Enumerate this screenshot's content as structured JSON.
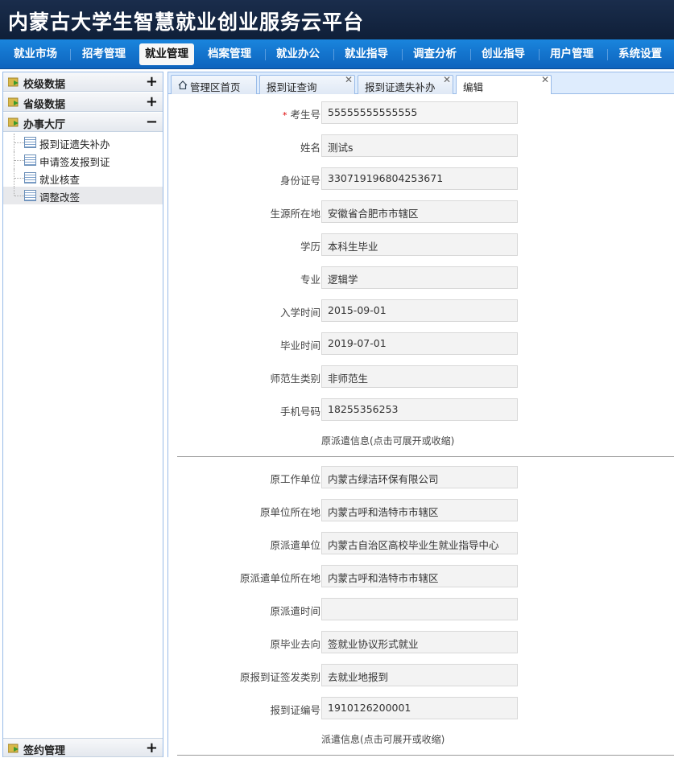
{
  "app": {
    "title": "内蒙古大学生智慧就业创业服务云平台"
  },
  "nav": [
    {
      "label": "就业市场"
    },
    {
      "label": "招考管理"
    },
    {
      "label": "就业管理",
      "active": true
    },
    {
      "label": "档案管理"
    },
    {
      "label": "就业办公"
    },
    {
      "label": "就业指导"
    },
    {
      "label": "调查分析"
    },
    {
      "label": "创业指导"
    },
    {
      "label": "用户管理"
    },
    {
      "label": "系统设置"
    }
  ],
  "sidebar": {
    "groups": [
      {
        "label": "校级数据",
        "toggle": "+"
      },
      {
        "label": "省级数据",
        "toggle": "+"
      },
      {
        "label": "办事大厅",
        "toggle": "−"
      }
    ],
    "items": [
      {
        "label": "报到证遗失补办"
      },
      {
        "label": "申请签发报到证"
      },
      {
        "label": "就业核查"
      },
      {
        "label": "调整改签",
        "selected": true
      }
    ],
    "bottom": {
      "label": "签约管理",
      "toggle": "+"
    }
  },
  "tabs": [
    {
      "label": "管理区首页",
      "icon": "home-icon",
      "closable": false
    },
    {
      "label": "报到证查询",
      "closable": true
    },
    {
      "label": "报到证遗失补办",
      "closable": true
    },
    {
      "label": "编辑",
      "closable": true,
      "active": true
    }
  ],
  "close_glyph": "✕",
  "form": {
    "required_mark": "*",
    "fields": [
      {
        "label": "考生号",
        "value": "55555555555555",
        "required": true
      },
      {
        "label": "姓名",
        "value": "测试s"
      },
      {
        "label": "身份证号",
        "value": "330719196804253671"
      },
      {
        "label": "生源所在地",
        "value": "安徽省合肥市市辖区"
      },
      {
        "label": "学历",
        "value": "本科生毕业"
      },
      {
        "label": "专业",
        "value": "逻辑学"
      },
      {
        "label": "入学时间",
        "value": "2015-09-01"
      },
      {
        "label": "毕业时间",
        "value": "2019-07-01"
      },
      {
        "label": "师范生类别",
        "value": "非师范生"
      },
      {
        "label": "手机号码",
        "value": "18255356253"
      }
    ],
    "section1_link": "原派遣信息(点击可展开或收缩)",
    "section1_fields": [
      {
        "label": "原工作单位",
        "value": "内蒙古绿洁环保有限公司"
      },
      {
        "label": "原单位所在地",
        "value": "内蒙古呼和浩特市市辖区"
      },
      {
        "label": "原派遣单位",
        "value": "内蒙古自治区高校毕业生就业指导中心"
      },
      {
        "label": "原派遣单位所在地",
        "value": "内蒙古呼和浩特市市辖区"
      },
      {
        "label": "原派遣时间",
        "value": ""
      },
      {
        "label": "原毕业去向",
        "value": "签就业协议形式就业"
      },
      {
        "label": "原报到证签发类别",
        "value": "去就业地报到"
      },
      {
        "label": "报到证编号",
        "value": "1910126200001"
      }
    ],
    "section2_link": "派遣信息(点击可展开或收缩)"
  }
}
